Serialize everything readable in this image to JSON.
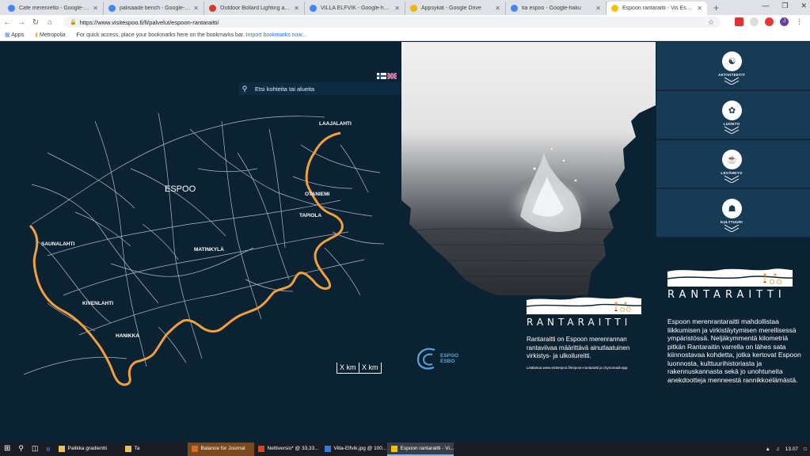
{
  "browser": {
    "tabs": [
      {
        "title": "Cafe merenrelto - Google-haku",
        "icon_color": "#4285f4",
        "icon": "google-icon"
      },
      {
        "title": "palisaade bench - Google-haku",
        "icon_color": "#4285f4",
        "icon": "google-icon"
      },
      {
        "title": "Outdoor Bollard Lighting and Lig",
        "icon_color": "#d23a2f",
        "icon": "site-icon"
      },
      {
        "title": "VILLA ELFVIK - Google-haku",
        "icon_color": "#4285f4",
        "icon": "google-icon"
      },
      {
        "title": "Appsykat - Google Drive",
        "icon_color": "#f4b400",
        "icon": "drive-icon"
      },
      {
        "title": "tia espoo - Google-haku",
        "icon_color": "#4285f4",
        "icon": "google-icon"
      },
      {
        "title": "Espoon rantaraitti - Vis Espoo",
        "icon_color": "#f4c20d",
        "icon": "site-icon",
        "active": true
      }
    ],
    "new_tab": "+",
    "url": "https://www.visitespoo.fi/fi/palvelut/espoon-rantaraitti/",
    "bookmarks_apps": "Apps",
    "bookmarks_metropolia": "Metropolia",
    "bookmarks_hint": "For quick access, place your bookmarks here on the bookmarks bar.",
    "bookmarks_import": "Import bookmarks now..."
  },
  "page": {
    "search_placeholder": "Etsi kohteita tai alueita",
    "map_title": "ESPOO",
    "places": [
      {
        "label": "LAAJALAHTI"
      },
      {
        "label": "OTANIEMI"
      },
      {
        "label": "TAPIOLA"
      },
      {
        "label": "SAUNALAHTI"
      },
      {
        "label": "MATINKYLÄ"
      },
      {
        "label": "KIVENLAHTI"
      },
      {
        "label": "HANIKKA"
      }
    ],
    "scale_1": "X km",
    "scale_2": "X km",
    "categories": [
      {
        "label": "AKTIVITEETIT",
        "icon": "activities-icon"
      },
      {
        "label": "LUONTO",
        "icon": "nature-icon"
      },
      {
        "label": "LEVÄHDYS",
        "icon": "rest-icon"
      },
      {
        "label": "KULTTUURI",
        "icon": "culture-icon"
      }
    ],
    "brand": "RANTARAITTI",
    "espoo_logo_1": "ESPOO",
    "espoo_logo_2": "ESBO",
    "description_short": "Rantaraitti on Espoon merenrannan rantaviivaa määrittävä ainutlaatuinen virkistys- ja ulkoilureitti.",
    "more_info": "Lisätietoa www.visitespoo.fi/espoon-rantaraitti ja citynomadi-app",
    "description_long": "Espoon merenrantaraitti mahdollistaa liikkumisen ja virkistäytymisen merellisessä ympäristössä. Neljäkymmentä kilometriä pitkän Rantaraitin varrella on lähes sata kiinnostavaa kohdetta, jotka kertovat Espoon luonnosta, kulttuurihistoriasta ja rakennuskannasta sekä jo unohtuneita anekdootteja menneestä rannikkoelämästä."
  },
  "taskbar": {
    "apps": [
      {
        "label": "Palikka gradientti",
        "color": "#e8c35a"
      },
      {
        "label": "Ta",
        "color": "#e8c35a"
      },
      {
        "label": "Balance for Journal",
        "color": "#d86b2a",
        "orange": true
      },
      {
        "label": "Nettiversio* @ 33,33...",
        "color": "#d04a2a"
      },
      {
        "label": "Villa-Elfvik.jpg @ 100...",
        "color": "#2f7bd8"
      },
      {
        "label": "Espoon rantaraitti - Vi...",
        "color": "#f4c20d",
        "active": true
      }
    ],
    "time": "13.07"
  },
  "colors": {
    "page_bg": "#0b2233",
    "route": "#f2a03d",
    "roads": "#c9d6e0",
    "panel": "#173a55"
  }
}
